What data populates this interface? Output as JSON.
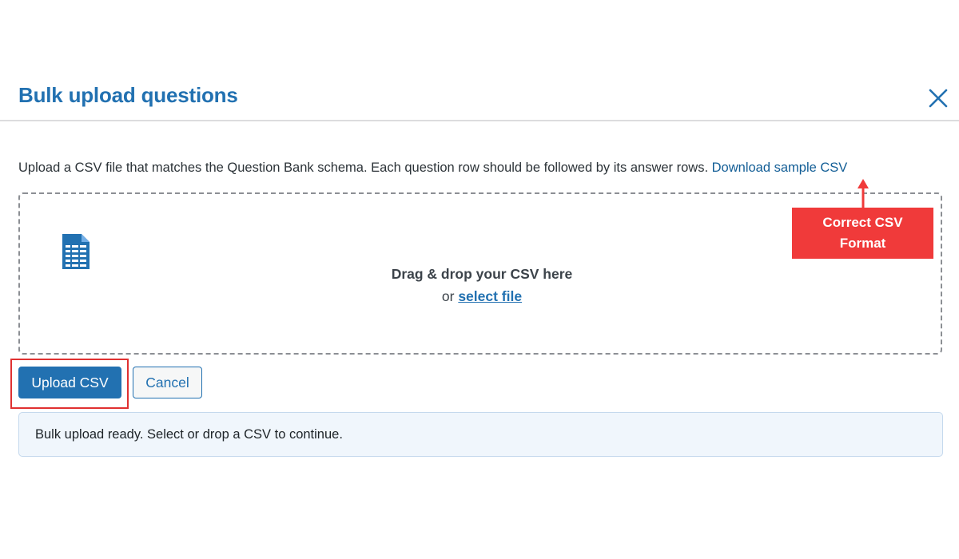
{
  "modal": {
    "title": "Bulk upload questions",
    "close_icon": "close-icon"
  },
  "description": {
    "text": "Upload a CSV file that matches the Question Bank schema. Each question row should be followed by its answer rows.",
    "link_label": "Download sample CSV"
  },
  "dropzone": {
    "icon": "csv-file-icon",
    "primary_text": "Drag & drop your CSV here",
    "or_text": "or",
    "select_link": "select file"
  },
  "annotation": {
    "line1": "Correct CSV",
    "line2": "Format",
    "color": "#f03a3a"
  },
  "actions": {
    "upload_label": "Upload CSV",
    "cancel_label": "Cancel"
  },
  "notice": {
    "text": "Bulk upload ready. Select or drop a CSV to continue."
  },
  "colors": {
    "accent": "#2271b1",
    "link": "#135e96",
    "notice_bg": "#f0f6fc",
    "highlight": "#e03131"
  }
}
